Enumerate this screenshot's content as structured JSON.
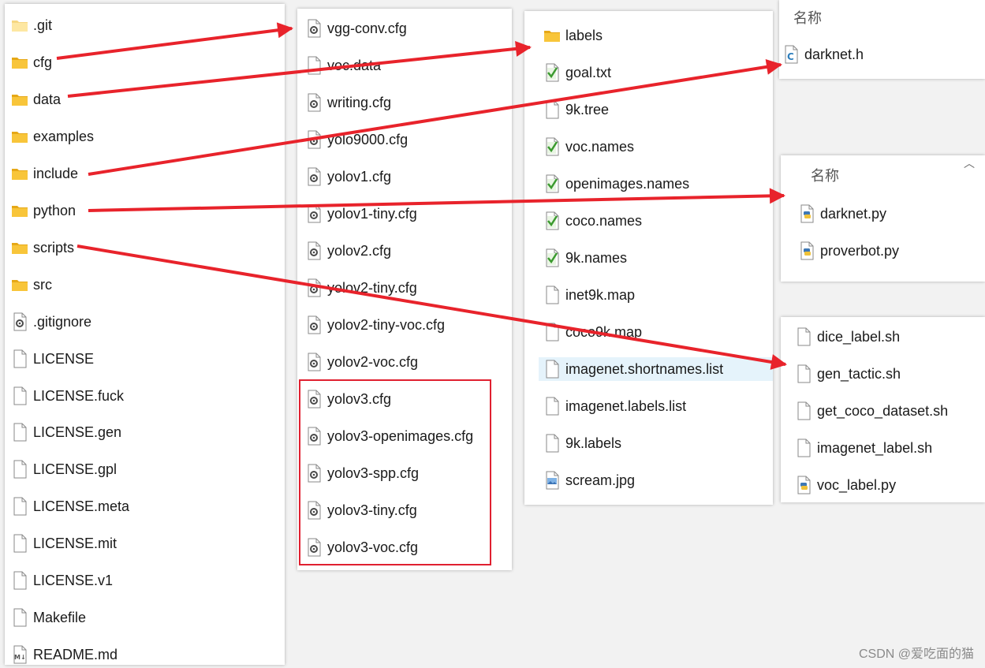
{
  "panels": {
    "root": {
      "items": [
        {
          "label": ".git",
          "icon": "folder-light-icon"
        },
        {
          "label": "cfg",
          "icon": "folder-icon"
        },
        {
          "label": "data",
          "icon": "folder-icon"
        },
        {
          "label": "examples",
          "icon": "folder-icon"
        },
        {
          "label": "include",
          "icon": "folder-icon"
        },
        {
          "label": "python",
          "icon": "folder-icon"
        },
        {
          "label": "scripts",
          "icon": "folder-icon"
        },
        {
          "label": "src",
          "icon": "folder-icon"
        },
        {
          "label": ".gitignore",
          "icon": "settings-file-icon"
        },
        {
          "label": "LICENSE",
          "icon": "file-icon"
        },
        {
          "label": "LICENSE.fuck",
          "icon": "file-icon"
        },
        {
          "label": "LICENSE.gen",
          "icon": "file-icon"
        },
        {
          "label": "LICENSE.gpl",
          "icon": "file-icon"
        },
        {
          "label": "LICENSE.meta",
          "icon": "file-icon"
        },
        {
          "label": "LICENSE.mit",
          "icon": "file-icon"
        },
        {
          "label": "LICENSE.v1",
          "icon": "file-icon"
        },
        {
          "label": "Makefile",
          "icon": "file-icon"
        },
        {
          "label": "README.md",
          "icon": "markdown-file-icon"
        }
      ]
    },
    "cfg": {
      "items": [
        {
          "label": "vgg-conv.cfg",
          "icon": "settings-file-icon"
        },
        {
          "label": "voc.data",
          "icon": "file-icon"
        },
        {
          "label": "writing.cfg",
          "icon": "settings-file-icon"
        },
        {
          "label": "yolo9000.cfg",
          "icon": "settings-file-icon"
        },
        {
          "label": "yolov1.cfg",
          "icon": "settings-file-icon"
        },
        {
          "label": "yolov1-tiny.cfg",
          "icon": "settings-file-icon"
        },
        {
          "label": "yolov2.cfg",
          "icon": "settings-file-icon"
        },
        {
          "label": "yolov2-tiny.cfg",
          "icon": "settings-file-icon"
        },
        {
          "label": "yolov2-tiny-voc.cfg",
          "icon": "settings-file-icon"
        },
        {
          "label": "yolov2-voc.cfg",
          "icon": "settings-file-icon"
        },
        {
          "label": "yolov3.cfg",
          "icon": "settings-file-icon"
        },
        {
          "label": "yolov3-openimages.cfg",
          "icon": "settings-file-icon"
        },
        {
          "label": "yolov3-spp.cfg",
          "icon": "settings-file-icon"
        },
        {
          "label": "yolov3-tiny.cfg",
          "icon": "settings-file-icon"
        },
        {
          "label": "yolov3-voc.cfg",
          "icon": "settings-file-icon"
        }
      ]
    },
    "data": {
      "items": [
        {
          "label": "labels",
          "icon": "folder-icon"
        },
        {
          "label": "goal.txt",
          "icon": "text-file-icon"
        },
        {
          "label": "9k.tree",
          "icon": "file-icon"
        },
        {
          "label": "voc.names",
          "icon": "text-file-icon"
        },
        {
          "label": "openimages.names",
          "icon": "text-file-icon"
        },
        {
          "label": "coco.names",
          "icon": "text-file-icon"
        },
        {
          "label": "9k.names",
          "icon": "text-file-icon"
        },
        {
          "label": "inet9k.map",
          "icon": "file-icon"
        },
        {
          "label": "coco9k.map",
          "icon": "file-icon"
        },
        {
          "label": "imagenet.shortnames.list",
          "icon": "file-icon",
          "selected": true
        },
        {
          "label": "imagenet.labels.list",
          "icon": "file-icon"
        },
        {
          "label": "9k.labels",
          "icon": "file-icon"
        },
        {
          "label": "scream.jpg",
          "icon": "image-file-icon"
        }
      ]
    },
    "include": {
      "header": "名称",
      "items": [
        {
          "label": "darknet.h",
          "icon": "c-header-file-icon"
        }
      ]
    },
    "python": {
      "header": "名称",
      "items": [
        {
          "label": "darknet.py",
          "icon": "python-file-icon"
        },
        {
          "label": "proverbot.py",
          "icon": "python-file-icon"
        }
      ]
    },
    "scripts": {
      "items": [
        {
          "label": "dice_label.sh",
          "icon": "file-icon"
        },
        {
          "label": "gen_tactic.sh",
          "icon": "file-icon"
        },
        {
          "label": "get_coco_dataset.sh",
          "icon": "file-icon"
        },
        {
          "label": "imagenet_label.sh",
          "icon": "file-icon"
        },
        {
          "label": "voc_label.py",
          "icon": "python-file-icon"
        }
      ]
    }
  },
  "annotations": {
    "arrow_color": "#e8232b",
    "highlight_color": "#e02030"
  },
  "watermark": "CSDN @爱吃面的猫"
}
